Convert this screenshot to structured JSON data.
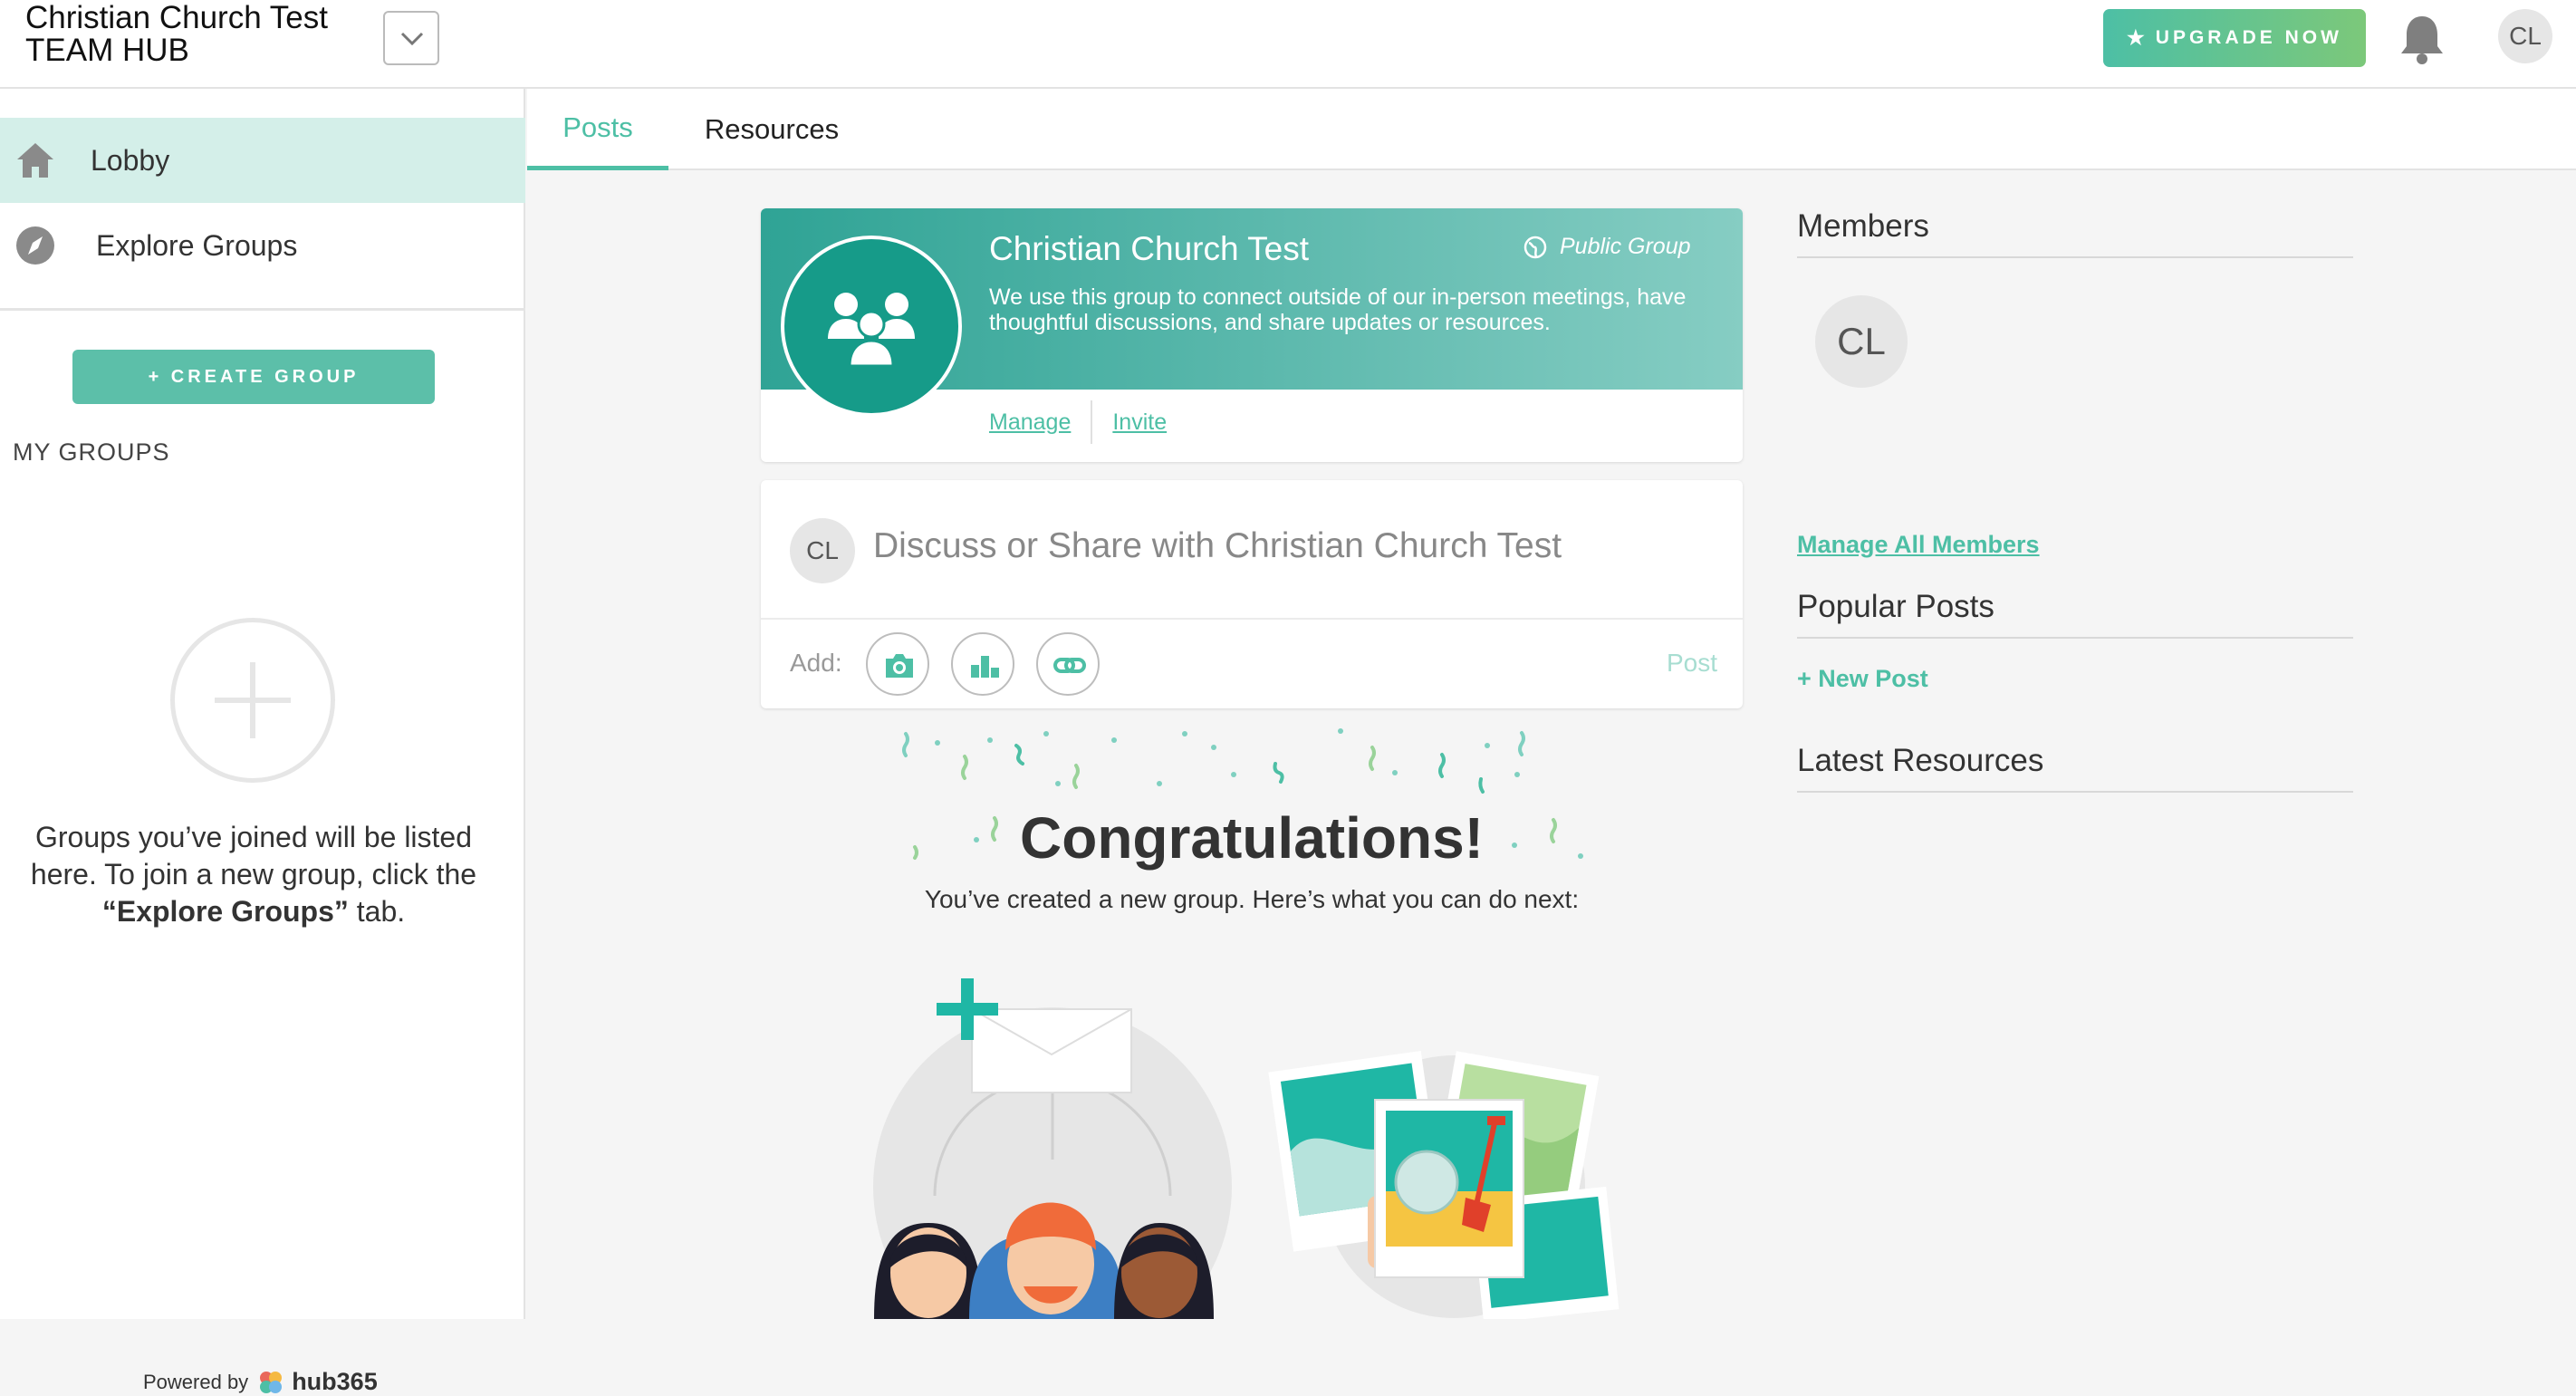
{
  "header": {
    "hub_name_line1": "Christian Church Test",
    "hub_name_line2": "TEAM HUB",
    "upgrade_label": "UPGRADE NOW",
    "user_initials": "CL"
  },
  "sidebar": {
    "items": [
      {
        "label": "Lobby",
        "icon": "home-icon",
        "active": true
      },
      {
        "label": "Explore Groups",
        "icon": "compass-icon",
        "active": false
      }
    ],
    "create_group_label": "+ CREATE GROUP",
    "my_groups_heading": "MY GROUPS",
    "empty_text_1": "Groups you’ve joined will be listed here. To join a new group, click the ",
    "empty_text_bold": "“Explore Groups”",
    "empty_text_2": " tab.",
    "powered_by": "Powered by",
    "powered_brand": "hub365"
  },
  "tabs": [
    {
      "label": "Posts",
      "active": true
    },
    {
      "label": "Resources",
      "active": false
    }
  ],
  "group": {
    "name": "Christian Church Test",
    "visibility": "Public Group",
    "description": "We use this group to connect outside of our in-person meetings, have thoughtful discussions, and share updates or resources.",
    "manage_label": "Manage",
    "invite_label": "Invite"
  },
  "composer": {
    "user_initials": "CL",
    "placeholder": "Discuss or Share with Christian Church Test",
    "add_label": "Add:",
    "post_label": "Post",
    "attachments": [
      "camera-icon",
      "poll-icon",
      "link-icon"
    ]
  },
  "congrats": {
    "title": "Congratulations!",
    "subtitle": "You’ve created a new group. Here’s what you can do next:"
  },
  "right": {
    "members_heading": "Members",
    "member_initials": "CL",
    "manage_all_label": "Manage All Members",
    "popular_heading": "Popular Posts",
    "new_post_label": "+ New Post",
    "latest_heading": "Latest Resources"
  },
  "colors": {
    "accent": "#4dbfa5",
    "banner_start": "#2fa395",
    "banner_end": "#86cdc3",
    "active_nav_bg": "#d4efe9"
  }
}
